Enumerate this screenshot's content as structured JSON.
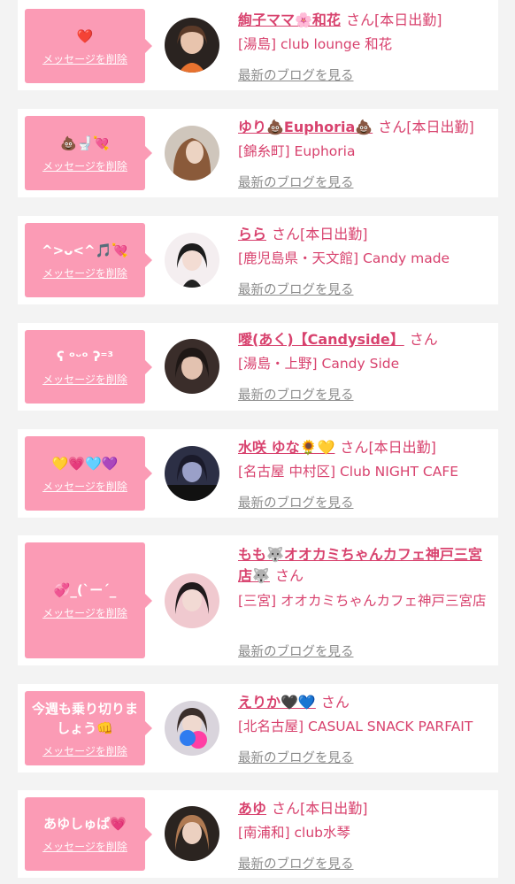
{
  "delete_label": "メッセージを削除",
  "blog_label": "最新のブログを見る",
  "san_label": "さん",
  "entries": [
    {
      "message": "❤️",
      "name": "絢子ママ🌸和花",
      "status": "[本日出勤]",
      "shop": "[湯島] club lounge 和花"
    },
    {
      "message": "💩🚽💘",
      "name": "ゆり💩Euphoria💩",
      "status": "[本日出勤]",
      "shop": "[錦糸町] Euphoria"
    },
    {
      "message": "^>ᴗ<^🎵💘",
      "name": "らら",
      "status": "[本日出勤]",
      "shop": "[鹿児島県・天文館] Candy made"
    },
    {
      "message": "ʕ ᵒᵕᵒ ʔ⁼³",
      "name": "噯(あく)【Candyside】",
      "status": "",
      "shop": "[湯島・上野] Candy Side"
    },
    {
      "message": "💛💗🩵💜",
      "name": "水咲 ゆな🌻💛",
      "status": "[本日出勤]",
      "shop": "[名古屋 中村区] Club NIGHT CAFE"
    },
    {
      "message": "💞_(`ー´_",
      "name": "もも🐺オオカミちゃんカフェ神戸三宮店🐺",
      "status": "",
      "shop": "[三宮] オオカミちゃんカフェ神戸三宮店"
    },
    {
      "message": "今週も乗り切りましょう👊",
      "name": "えりか🖤💙",
      "status": "",
      "shop": "[北名古屋] CASUAL SNACK PARFAIT"
    },
    {
      "message": "あゆしゅぱ💗",
      "name": "あゆ",
      "status": "[本日出勤]",
      "shop": "[南浦和] club水琴"
    }
  ]
}
